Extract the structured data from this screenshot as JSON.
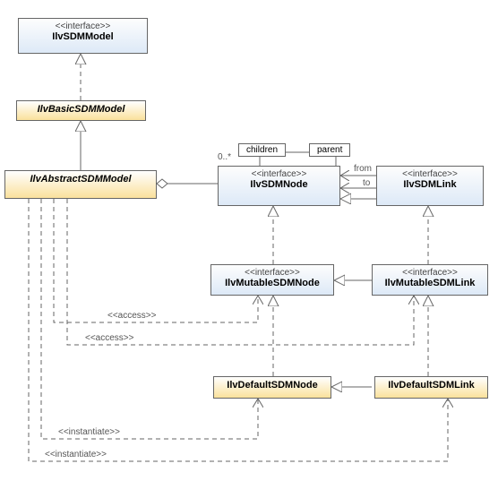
{
  "nodes": {
    "sdmModel": {
      "stereo": "<<interface>>",
      "name": "IlvSDMModel"
    },
    "basicSDMModel": {
      "name": "IlvBasicSDMModel"
    },
    "abstractSDMModel": {
      "name": "IlvAbstractSDMModel"
    },
    "sdmNode": {
      "stereo": "<<interface>>",
      "name": "IlvSDMNode"
    },
    "sdmLink": {
      "stereo": "<<interface>>",
      "name": "IlvSDMLink"
    },
    "mutableNode": {
      "stereo": "<<interface>>",
      "name": "IlvMutableSDMNode"
    },
    "mutableLink": {
      "stereo": "<<interface>>",
      "name": "IlvMutableSDMLink"
    },
    "defaultNode": {
      "name": "IlvDefaultSDMNode"
    },
    "defaultLink": {
      "name": "IlvDefaultSDMLink"
    }
  },
  "labels": {
    "children": "children",
    "parent": "parent",
    "from": "from",
    "to": "to",
    "mult": "0..*",
    "access": "<<access>>",
    "instantiate": "<<instantiate>>"
  }
}
